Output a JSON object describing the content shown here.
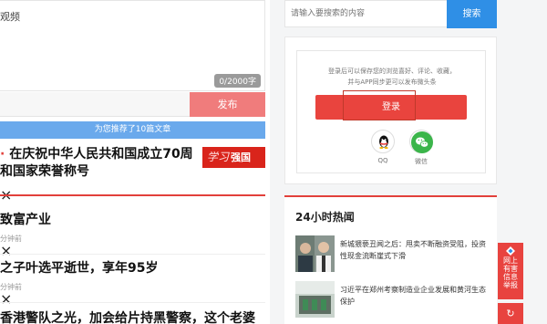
{
  "post": {
    "placeholder_tail": "观频",
    "counter": "0/2000字",
    "publish_label": "发布"
  },
  "recommend_bar": "为您推荐了10篇文章",
  "news": [
    {
      "title_line1": "在庆祝中华人民共和国成立70周",
      "title_line2": "和国家荣誉称号",
      "meta": ""
    },
    {
      "title_line1": "致富产业",
      "meta": "分钟前"
    },
    {
      "title_line1": "之子叶选平逝世，享年95岁",
      "meta": "分钟前"
    },
    {
      "title_line1": "香港警队之光，加会给片持黑警察，这个老婆",
      "meta": ""
    }
  ],
  "xuexi": {
    "hand": "学习",
    "label": "强国"
  },
  "search": {
    "placeholder": "请输入要搜索的内容",
    "button": "搜索"
  },
  "login": {
    "tip_line1": "登录后可以保存您的浏览喜好、评论、收藏，",
    "tip_line2": "并与APP同步更可以发布微头条",
    "button": "登录",
    "qq_label": "QQ",
    "wechat_label": "微信"
  },
  "hot": {
    "title": "24小时热闻",
    "items": [
      {
        "text": "新城猥亵丑闻之后：甩卖不断融资受阻，投资性现金流断崖式下滑"
      },
      {
        "text": "习近平在郑州考察制造业企业发展和黄河生态保护"
      }
    ]
  },
  "float": {
    "report": "网上有害信息举报",
    "refresh": "↻"
  },
  "colors": {
    "accent_red": "#e2403b",
    "blue": "#2f8fe6"
  }
}
